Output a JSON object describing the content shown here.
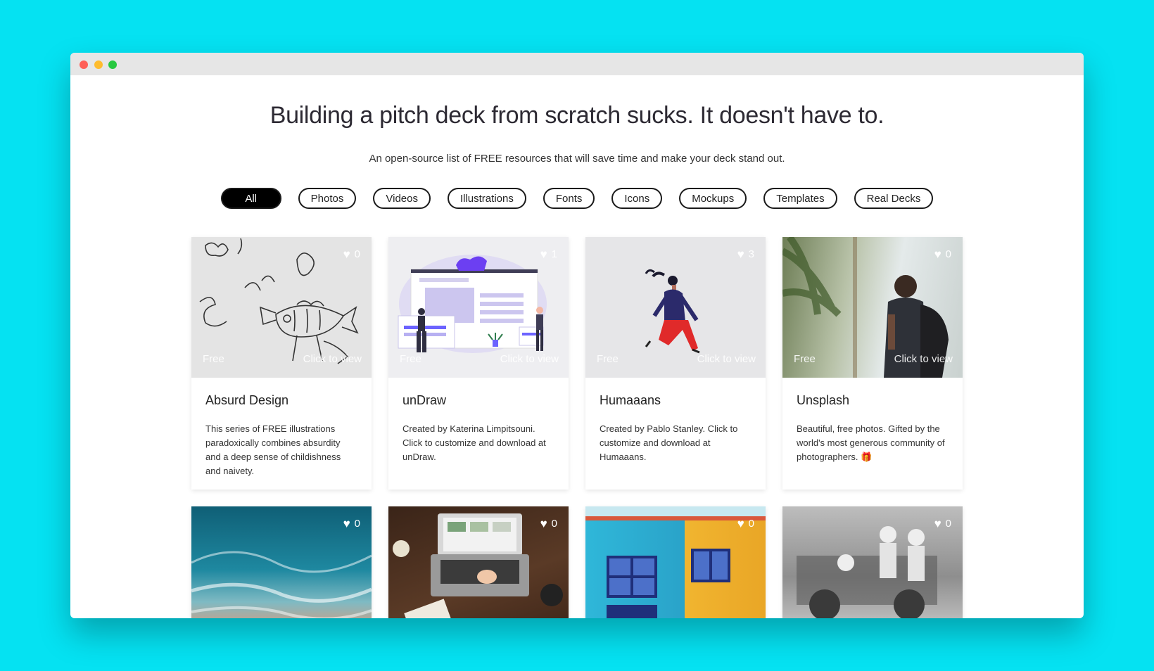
{
  "headline": "Building a pitch deck from scratch sucks. It doesn't have to.",
  "subtitle": "An open-source list of FREE resources that will save time and make your deck stand out.",
  "filters": [
    {
      "label": "All",
      "active": true
    },
    {
      "label": "Photos"
    },
    {
      "label": "Videos"
    },
    {
      "label": "Illustrations"
    },
    {
      "label": "Fonts"
    },
    {
      "label": "Icons"
    },
    {
      "label": "Mockups"
    },
    {
      "label": "Templates"
    },
    {
      "label": "Real Decks"
    }
  ],
  "overlay": {
    "free": "Free",
    "view": "Click to view"
  },
  "cards": [
    {
      "title": "Absurd Design",
      "likes": "0",
      "desc": "This series of FREE illustrations paradoxically combines absurdity and a deep sense of childishness and naivety."
    },
    {
      "title": "unDraw",
      "likes": "1",
      "desc": "Created by Katerina Limpitsouni. Click to customize and download at unDraw."
    },
    {
      "title": "Humaaans",
      "likes": "3",
      "desc": "Created by Pablo Stanley. Click to customize and download at Humaaans."
    },
    {
      "title": "Unsplash",
      "likes": "0",
      "desc": "Beautiful, free photos. Gifted by the world's most generous community of photographers. 🎁"
    },
    {
      "likes": "0"
    },
    {
      "likes": "0"
    },
    {
      "likes": "0"
    },
    {
      "likes": "0"
    }
  ]
}
